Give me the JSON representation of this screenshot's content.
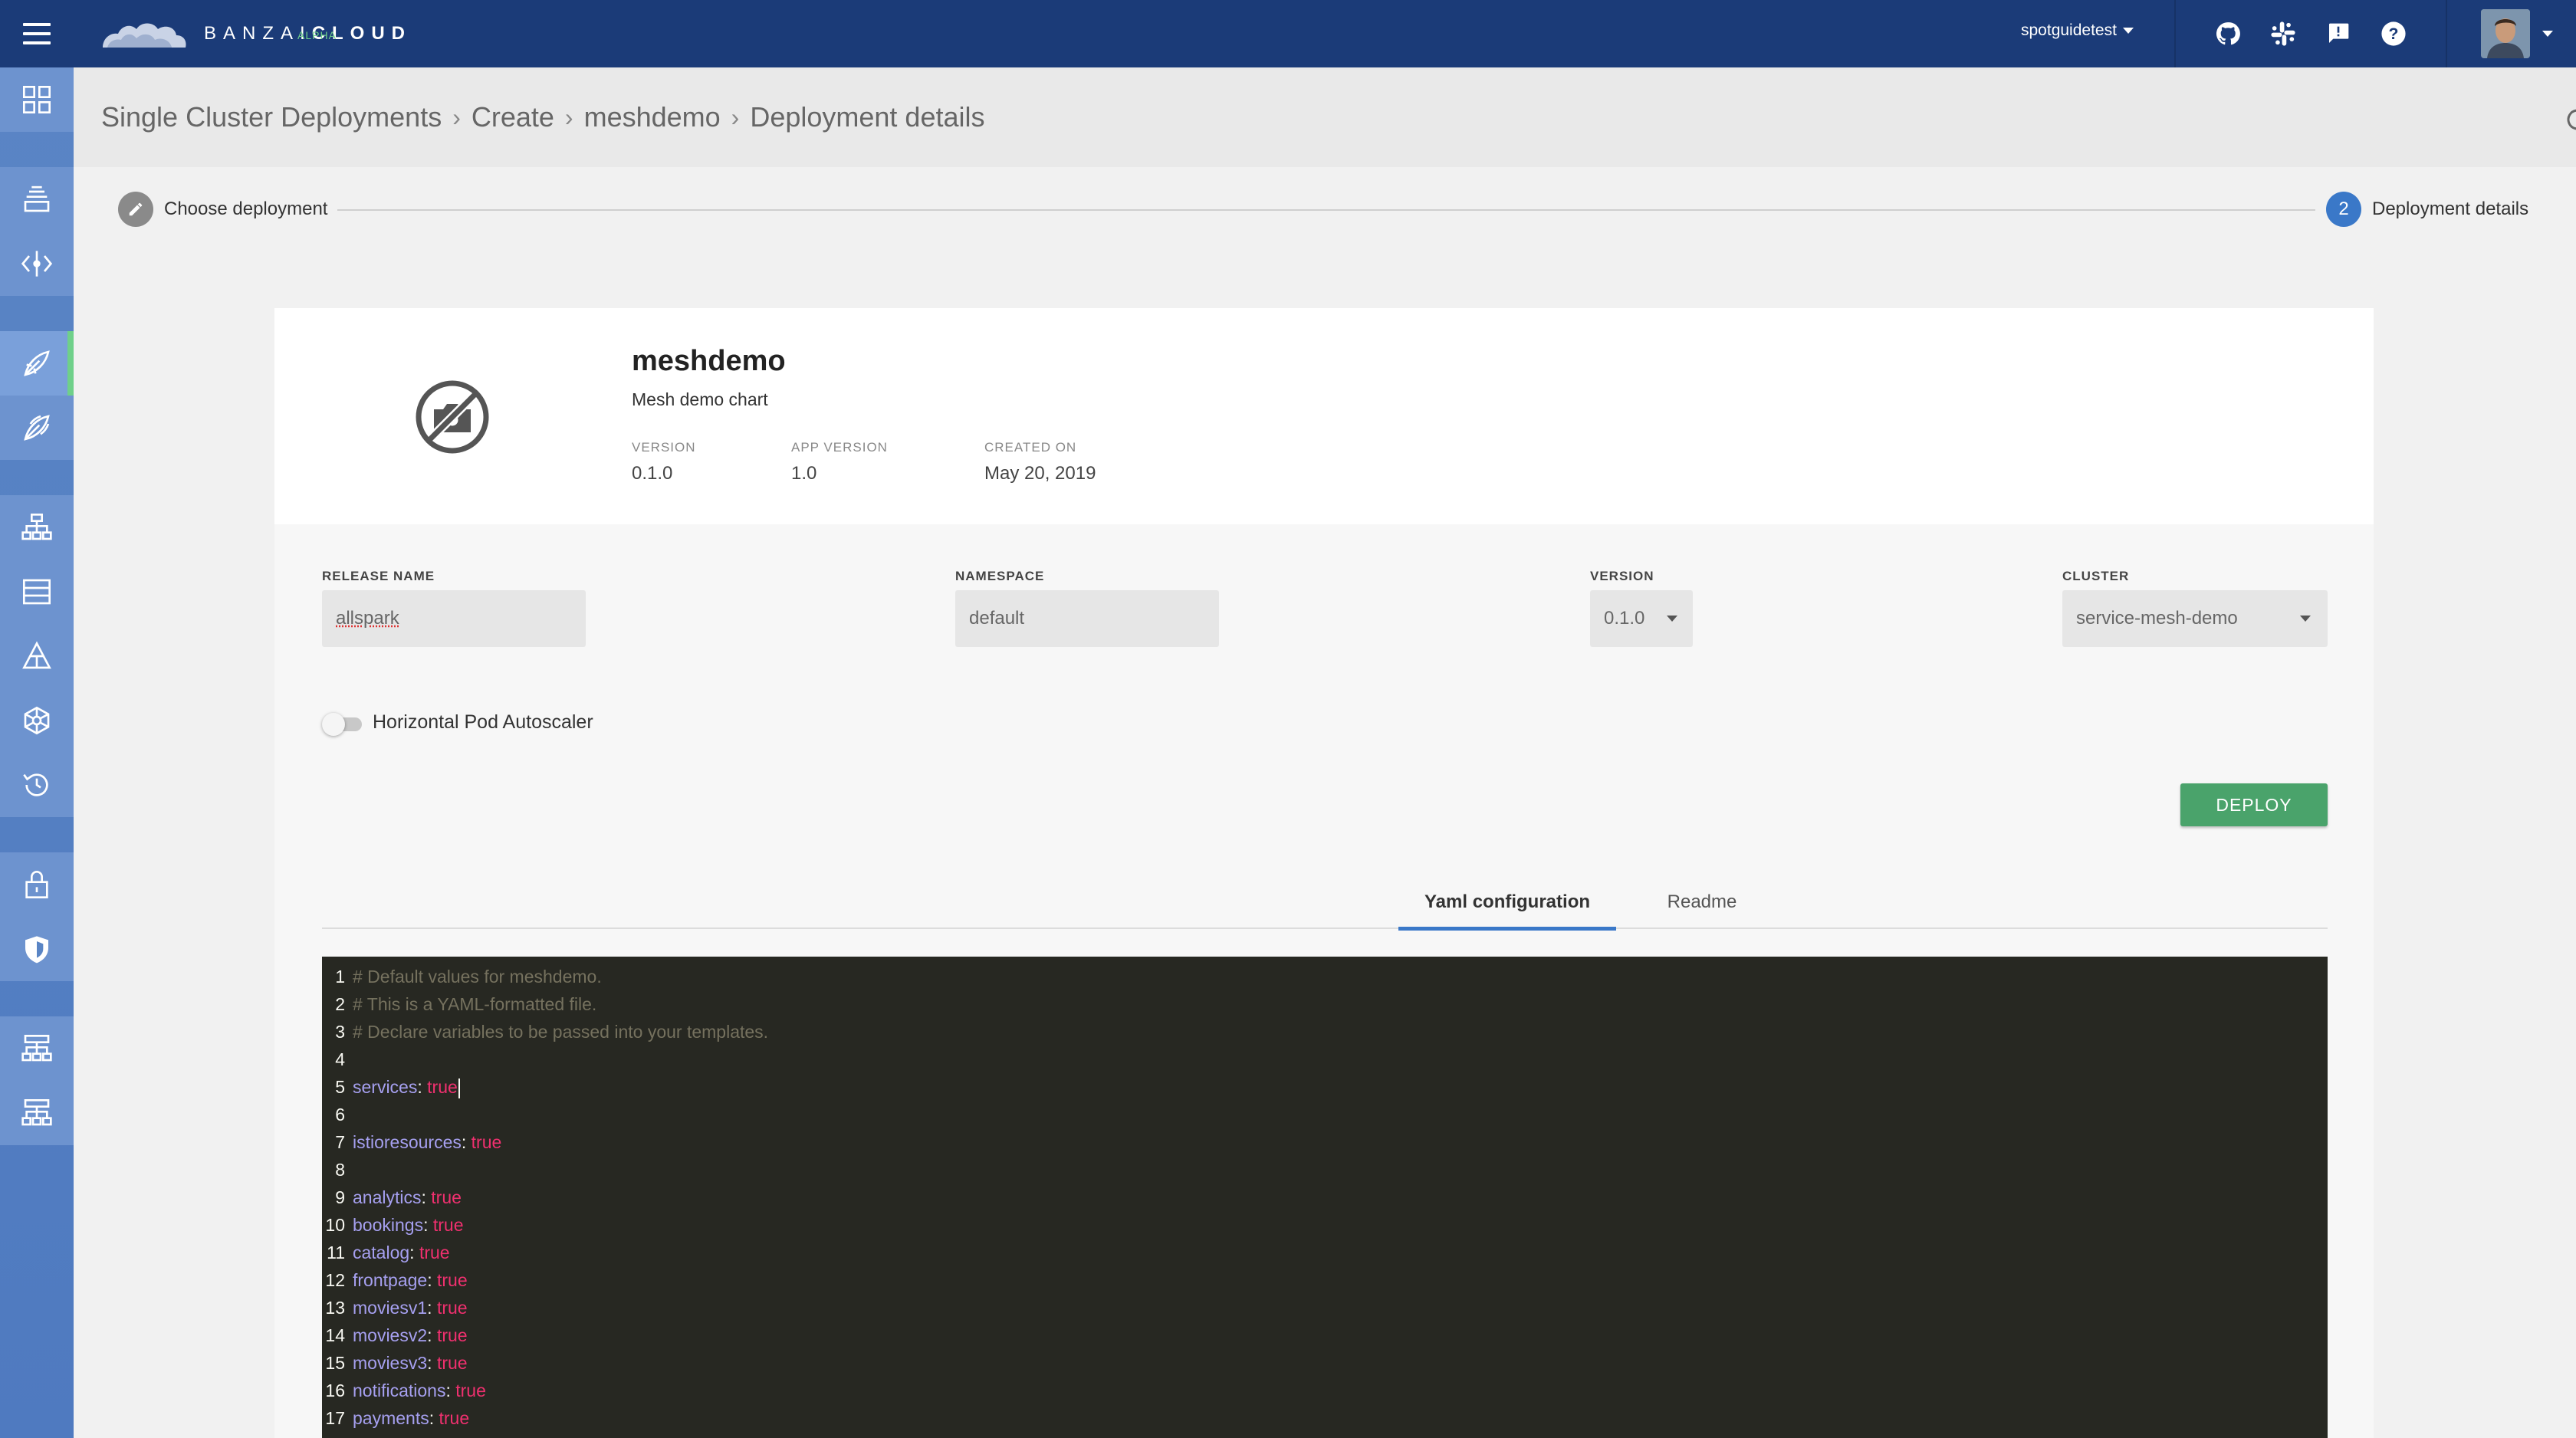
{
  "app": {
    "logo_text_light": "BANZAI",
    "logo_text_bold": "CLOUD",
    "logo_badge": "ALPHA"
  },
  "topbar": {
    "user_menu_label": "spotguidetest",
    "icons": [
      "github-icon",
      "slack-icon",
      "feedback-icon",
      "help-icon"
    ]
  },
  "breadcrumb": {
    "items": [
      "Single Cluster Deployments",
      "Create",
      "meshdemo",
      "Deployment details"
    ],
    "separator": "›"
  },
  "stepper": {
    "step1_label": "Choose deployment",
    "step2_number": "2",
    "step2_label": "Deployment details"
  },
  "chart": {
    "name": "meshdemo",
    "description": "Mesh demo chart",
    "version_label": "VERSION",
    "version_value": "0.1.0",
    "app_version_label": "APP VERSION",
    "app_version_value": "1.0",
    "created_label": "CREATED ON",
    "created_value": "May 20, 2019"
  },
  "form": {
    "release_name_label": "RELEASE NAME",
    "release_name_value": "allspark",
    "namespace_label": "NAMESPACE",
    "namespace_value": "default",
    "version_label": "VERSION",
    "version_value": "0.1.0",
    "cluster_label": "CLUSTER",
    "cluster_value": "service-mesh-demo",
    "hpa_label": "Horizontal Pod Autoscaler",
    "hpa_enabled": false,
    "deploy_label": "DEPLOY"
  },
  "tabs": {
    "yaml_label": "Yaml configuration",
    "readme_label": "Readme",
    "active": "yaml"
  },
  "editor": {
    "lines": [
      {
        "n": "1",
        "comment": "# Default values for meshdemo."
      },
      {
        "n": "2",
        "comment": "# This is a YAML-formatted file."
      },
      {
        "n": "3",
        "comment": "# Declare variables to be passed into your templates."
      },
      {
        "n": "4"
      },
      {
        "n": "5",
        "key": "services",
        "val": "true",
        "cursor": true
      },
      {
        "n": "6"
      },
      {
        "n": "7",
        "key": "istioresources",
        "val": "true"
      },
      {
        "n": "8"
      },
      {
        "n": "9",
        "key": "analytics",
        "val": "true"
      },
      {
        "n": "10",
        "key": "bookings",
        "val": "true"
      },
      {
        "n": "11",
        "key": "catalog",
        "val": "true"
      },
      {
        "n": "12",
        "key": "frontpage",
        "val": "true"
      },
      {
        "n": "13",
        "key": "moviesv1",
        "val": "true"
      },
      {
        "n": "14",
        "key": "moviesv2",
        "val": "true"
      },
      {
        "n": "15",
        "key": "moviesv3",
        "val": "true"
      },
      {
        "n": "16",
        "key": "notifications",
        "val": "true"
      },
      {
        "n": "17",
        "key": "payments",
        "val": "true"
      }
    ]
  },
  "colors": {
    "topbar": "#1b3b78",
    "sidebar": "#5a85c5",
    "accent_green": "#4aa36b",
    "tab_underline": "#3a78c8",
    "editor_bg": "#272822"
  }
}
